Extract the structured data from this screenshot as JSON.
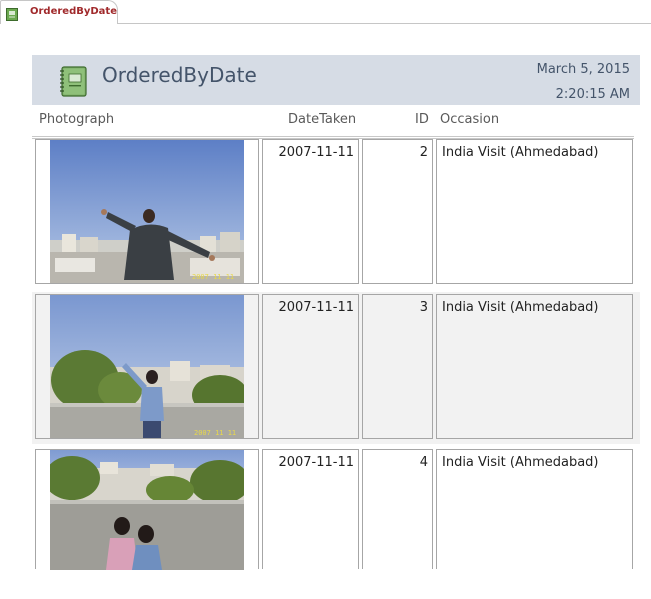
{
  "tab": {
    "label": "OrderedByDate",
    "icon": "report-icon"
  },
  "header": {
    "title": "OrderedByDate",
    "date": "March 5, 2015",
    "time": "2:20:15 AM",
    "icon": "notebook-icon"
  },
  "columns": {
    "photograph": "Photograph",
    "date_taken": "DateTaken",
    "id": "ID",
    "occasion": "Occasion"
  },
  "rows": [
    {
      "date_taken": "2007-11-11",
      "id": "2",
      "occasion": "India Visit (Ahmedabad)",
      "photo": "photo-man-flying-kite",
      "stamp": "2007 11 11"
    },
    {
      "date_taken": "2007-11-11",
      "id": "3",
      "occasion": "India Visit (Ahmedabad)",
      "photo": "photo-girl-flying-kite",
      "stamp": "2007 11 11"
    },
    {
      "date_taken": "2007-11-11",
      "id": "4",
      "occasion": "India Visit (Ahmedabad)",
      "photo": "photo-children-on-roof",
      "stamp": ""
    }
  ],
  "colors": {
    "header_bg": "#d6dce5",
    "title_color": "#44546a",
    "tab_label_color": "#a0292b",
    "alt_row_bg": "#f2f2f2"
  }
}
